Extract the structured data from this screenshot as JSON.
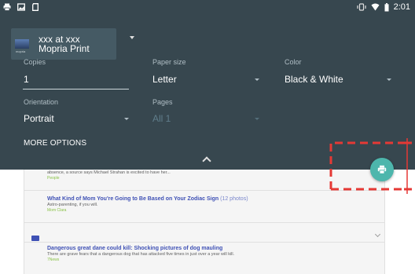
{
  "status_bar": {
    "time": "2:01",
    "left_icons": [
      "print-icon",
      "image-icon",
      "sd-card-icon"
    ],
    "right_icons": [
      "vibrate-icon",
      "wifi-icon",
      "battery-icon"
    ]
  },
  "print_dialog": {
    "printer": {
      "name": "xxx at xxx",
      "service": "Mopria Print",
      "thumbnail_caption": "mopria"
    },
    "copies": {
      "label": "Copies",
      "value": "1"
    },
    "paper_size": {
      "label": "Paper size",
      "value": "Letter"
    },
    "color": {
      "label": "Color",
      "value": "Black & White"
    },
    "orientation": {
      "label": "Orientation",
      "value": "Portrait"
    },
    "pages": {
      "label": "Pages",
      "value": "All 1"
    },
    "more_options": "MORE OPTIONS",
    "print_button_icon": "print-icon"
  },
  "background_feed": {
    "items": [
      {
        "body": "Kelly and Michael are working things out. A day after PEOPLE exclusively confirmed that Kelly Ripa would be return to Live! With Kelly and Michael' after a nearly weeklong absence, a source says Michael Strahan is excited to have her...",
        "source": "People"
      },
      {
        "title": "What Kind of Mom You're Going to Be Based on Your Zodiac Sign",
        "count": "(12 photos)",
        "body": "Astro-parenting, if you will.",
        "source": "Mom Clara"
      },
      {
        "title": "Dangerous great dane could kill: Shocking pictures of dog mauling",
        "body": "There are grave fears that a dangerous dog that has attacked five times in just over a year will kill.",
        "source": "7News"
      }
    ]
  },
  "colors": {
    "panel_background": "#37474f",
    "fab_accent": "#4db6ac",
    "annotation_dash": "#e53935"
  }
}
